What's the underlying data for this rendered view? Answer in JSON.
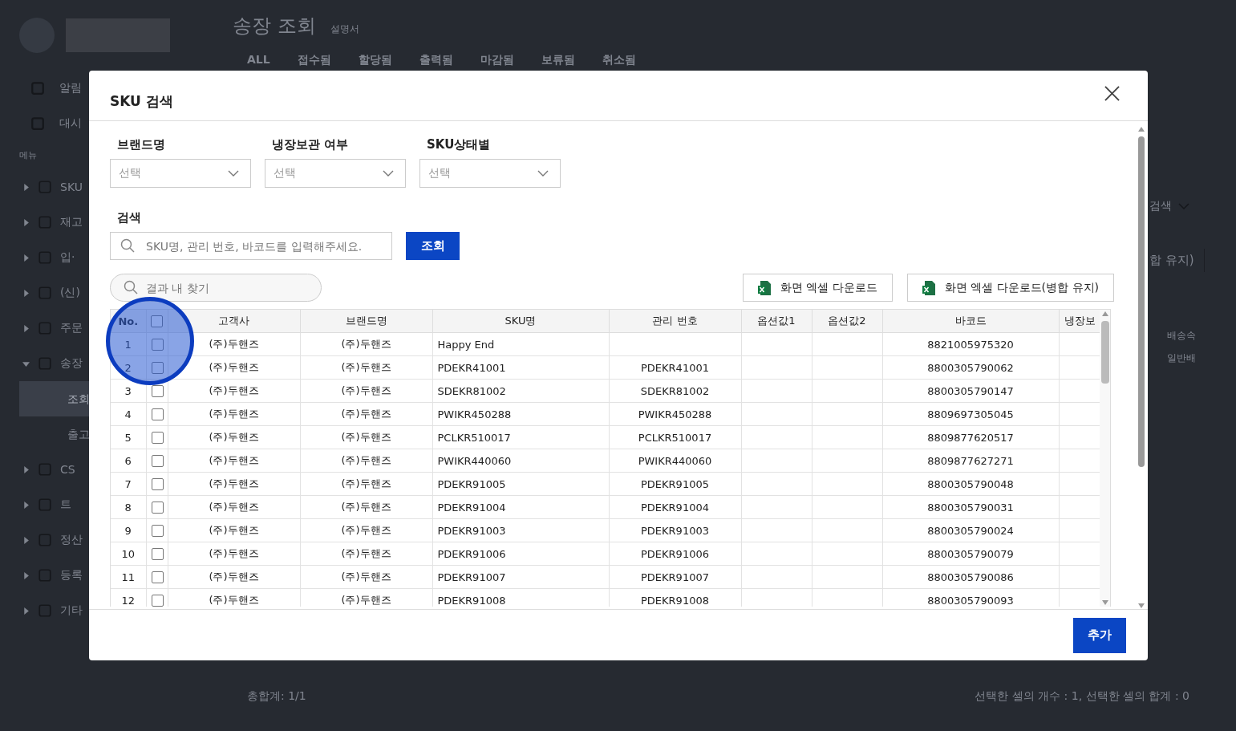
{
  "background": {
    "page_title": "송장 조회",
    "manual_link": "설명서",
    "tabs": [
      "ALL",
      "접수됨",
      "할당됨",
      "출력됨",
      "마감됨",
      "보류됨",
      "취소됨"
    ],
    "sidebar": {
      "top_items": [
        "알림",
        "대시"
      ],
      "section_label": "메뉴",
      "menu_items": [
        {
          "label": "SKU",
          "expanded": false
        },
        {
          "label": "재고",
          "expanded": false
        },
        {
          "label": "입·",
          "expanded": false
        },
        {
          "label": "(신)",
          "expanded": false
        },
        {
          "label": "주문",
          "expanded": false
        },
        {
          "label": "송장",
          "expanded": true,
          "children": [
            {
              "label": "조회",
              "selected": true
            },
            {
              "label": "출고",
              "selected": false
            }
          ]
        },
        {
          "label": "CS",
          "expanded": false
        },
        {
          "label": "트",
          "expanded": false
        },
        {
          "label": "정산",
          "expanded": false
        },
        {
          "label": "등록",
          "expanded": false
        },
        {
          "label": "기타",
          "expanded": false
        }
      ]
    },
    "right_fragments": {
      "search_toggle": "검색",
      "merge_button": "합 유지)",
      "column_header": "배송속",
      "cell": "일반배"
    },
    "status_bar": {
      "total": "총합계: 1/1",
      "selection": "선택한 셀의 개수 : 1, 선택한 셀의 합계 : 0"
    }
  },
  "modal": {
    "title": "SKU 검색",
    "filters": [
      {
        "label": "브랜드명",
        "placeholder": "선택"
      },
      {
        "label": "냉장보관 여부",
        "placeholder": "선택"
      },
      {
        "label": "SKU상태별",
        "placeholder": "선택"
      }
    ],
    "search": {
      "label": "검색",
      "placeholder": "SKU명, 관리 번호, 바코드를 입력해주세요.",
      "button": "조회"
    },
    "find_in_results": {
      "placeholder": "결과 내 찾기"
    },
    "download_buttons": [
      "화면 엑셀 다운로드",
      "화면 엑셀 다운로드(병합 유지)"
    ],
    "table": {
      "columns": [
        "No.",
        "고객사",
        "브랜드명",
        "SKU명",
        "관리 번호",
        "옵션값1",
        "옵션값2",
        "바코드",
        "냉장보"
      ],
      "header_checked": false,
      "rows": [
        {
          "no": "1",
          "checked": false,
          "customer": "(주)두핸즈",
          "brand": "(주)두핸즈",
          "sku": "Happy End",
          "barcode": "8821005975320"
        },
        {
          "no": "2",
          "checked": false,
          "customer": "(주)두핸즈",
          "brand": "(주)두핸즈",
          "sku": "PDEKR41001",
          "code": "PDEKR41001",
          "barcode": "8800305790062"
        },
        {
          "no": "3",
          "checked": false,
          "customer": "(주)두핸즈",
          "brand": "(주)두핸즈",
          "sku": "SDEKR81002",
          "code": "SDEKR81002",
          "barcode": "8800305790147"
        },
        {
          "no": "4",
          "checked": false,
          "customer": "(주)두핸즈",
          "brand": "(주)두핸즈",
          "sku": "PWIKR450288",
          "code": "PWIKR450288",
          "barcode": "8809697305045"
        },
        {
          "no": "5",
          "checked": false,
          "customer": "(주)두핸즈",
          "brand": "(주)두핸즈",
          "sku": "PCLKR510017",
          "code": "PCLKR510017",
          "barcode": "8809877620517"
        },
        {
          "no": "6",
          "checked": false,
          "customer": "(주)두핸즈",
          "brand": "(주)두핸즈",
          "sku": "PWIKR440060",
          "code": "PWIKR440060",
          "barcode": "8809877627271"
        },
        {
          "no": "7",
          "checked": false,
          "customer": "(주)두핸즈",
          "brand": "(주)두핸즈",
          "sku": "PDEKR91005",
          "code": "PDEKR91005",
          "barcode": "8800305790048"
        },
        {
          "no": "8",
          "checked": false,
          "customer": "(주)두핸즈",
          "brand": "(주)두핸즈",
          "sku": "PDEKR91004",
          "code": "PDEKR91004",
          "barcode": "8800305790031"
        },
        {
          "no": "9",
          "checked": false,
          "customer": "(주)두핸즈",
          "brand": "(주)두핸즈",
          "sku": "PDEKR91003",
          "code": "PDEKR91003",
          "barcode": "8800305790024"
        },
        {
          "no": "10",
          "checked": false,
          "customer": "(주)두핸즈",
          "brand": "(주)두핸즈",
          "sku": "PDEKR91006",
          "code": "PDEKR91006",
          "barcode": "8800305790079"
        },
        {
          "no": "11",
          "checked": false,
          "customer": "(주)두핸즈",
          "brand": "(주)두핸즈",
          "sku": "PDEKR91007",
          "code": "PDEKR91007",
          "barcode": "8800305790086"
        },
        {
          "no": "12",
          "checked": false,
          "customer": "(주)두핸즈",
          "brand": "(주)두핸즈",
          "sku": "PDEKR91008",
          "code": "PDEKR91008",
          "barcode": "8800305790093"
        }
      ]
    },
    "add_button": "추가"
  }
}
